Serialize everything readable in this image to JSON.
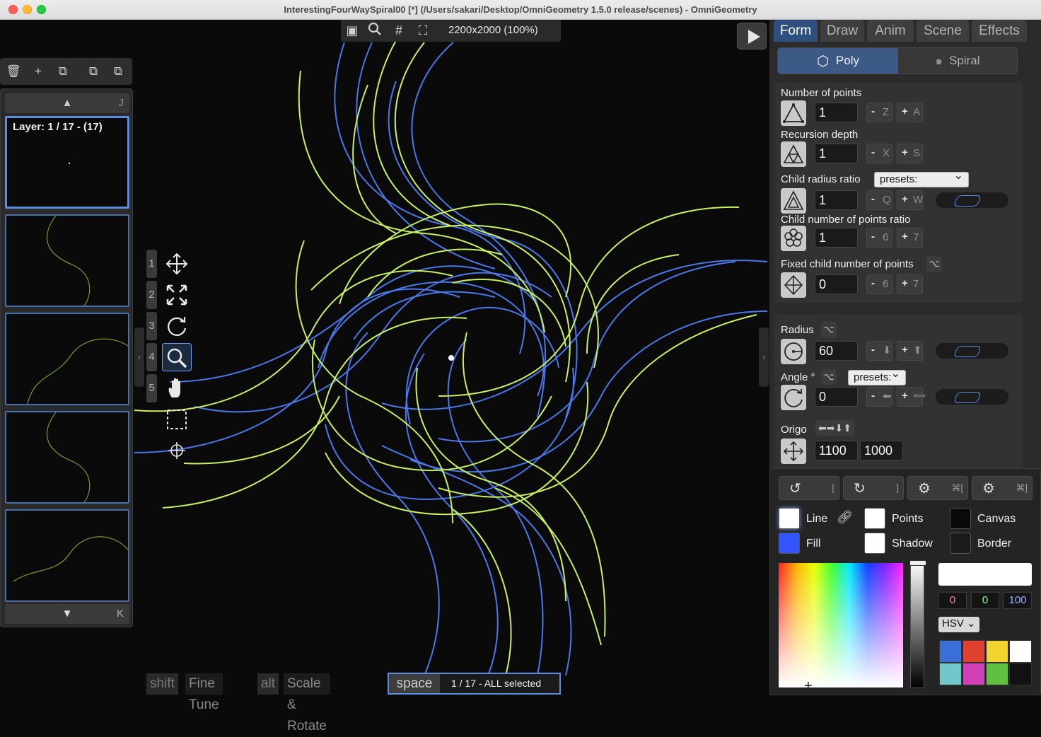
{
  "window": {
    "title": "InterestingFourWaySpiral00 [*] (/Users/sakari/Desktop/OmniGeometry 1.5.0 release/scenes) - OmniGeometry"
  },
  "canvas_toolbar": {
    "size_label": "2200x2000 (100%)",
    "icons": [
      "sidebar-icon",
      "search-icon",
      "grid-icon",
      "fullscreen-icon"
    ]
  },
  "layers": {
    "up_key": "J",
    "down_key": "K",
    "label": "Layer: 1 / 17 - (17)",
    "toolbar_icons": [
      "trash-icon",
      "plus-icon",
      "duplicate-icon",
      "layer-up-icon",
      "layer-down-icon"
    ]
  },
  "tools": {
    "numbers": [
      "1",
      "2",
      "3",
      "4",
      "5"
    ],
    "active": "zoom"
  },
  "status": {
    "shift_key": "shift",
    "shift_label": "Fine Tune",
    "alt_key": "alt",
    "alt_label": "Scale & Rotate",
    "space_key": "space",
    "selection": "1 / 17 - ALL selected"
  },
  "tabs": [
    "Form",
    "Draw",
    "Anim",
    "Scene",
    "Effects"
  ],
  "active_tab": "Form",
  "shape_toggle": {
    "poly": "Poly",
    "spiral": "Spiral",
    "active": "Poly"
  },
  "form": {
    "num_points": {
      "label": "Number of points",
      "value": "1",
      "dec_key": "Z",
      "inc_key": "A"
    },
    "recursion": {
      "label": "Recursion depth",
      "value": "1",
      "dec_key": "X",
      "inc_key": "S"
    },
    "child_radius": {
      "label": "Child radius ratio",
      "value": "1",
      "dec_key": "Q",
      "inc_key": "W",
      "presets": "presets:"
    },
    "child_num_points": {
      "label": "Child number of points ratio",
      "value": "1",
      "dec_key": "6",
      "inc_key": "7"
    },
    "fixed_child": {
      "label": "Fixed child number of points",
      "value": "0",
      "dec_key": "6",
      "inc_key": "7",
      "alt": "⌥"
    }
  },
  "transform": {
    "radius": {
      "label": "Radius",
      "value": "60",
      "alt": "⌥",
      "dec_key": "⬇",
      "inc_key": "⬆"
    },
    "angle": {
      "label": "Angle °",
      "value": "0",
      "alt": "⌥",
      "presets": "presets:",
      "dec_key": "⬅",
      "inc_key": "➖"
    },
    "origo": {
      "label": "Origo",
      "x": "1100",
      "y": "1000",
      "keys": "⬅➡⬇⬆"
    }
  },
  "color_panel": {
    "buttons": [
      {
        "icon": "rotate-ccw-icon",
        "key": "["
      },
      {
        "icon": "rotate-cw-icon",
        "key": "]"
      },
      {
        "icon": "gear-icon",
        "key": "⌘["
      },
      {
        "icon": "gear-icon",
        "key": "⌘]"
      }
    ],
    "line_label": "Line",
    "fill_label": "Fill",
    "points_label": "Points",
    "shadow_label": "Shadow",
    "canvas_label": "Canvas",
    "border_label": "Border",
    "colors": {
      "line": "#ffffff",
      "fill": "#3355ff",
      "points": "#ffffff",
      "shadow": "#ffffff",
      "canvas": "#0a0a0a",
      "border": "#1a1a1a"
    },
    "values": {
      "h": "0",
      "s": "0",
      "v": "100"
    },
    "mode": "HSV",
    "palette": [
      "#3a6fd8",
      "#e04030",
      "#f2d430",
      "#ffffff",
      "#70c8c8",
      "#d040b8",
      "#60c040",
      "#111111"
    ]
  },
  "spiral_colors": {
    "blue": "#4a78e8",
    "green": "#c8f060"
  }
}
